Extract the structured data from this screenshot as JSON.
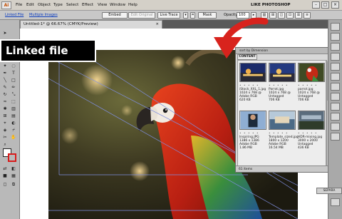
{
  "menubar": {
    "logo": "Ai",
    "items": [
      "File",
      "Edit",
      "Object",
      "Type",
      "Select",
      "Effect",
      "View",
      "Window",
      "Help"
    ],
    "app_title": "LIKE PHOTOSHOP",
    "window_buttons": [
      "–",
      "□",
      "×"
    ]
  },
  "controlbar": {
    "linked_file": "Linked File",
    "multiple_images": "Multiple Images",
    "embed": "Embed",
    "edit_original": "Edit Original",
    "live_trace": "Live Trace",
    "mask": "Mask",
    "opacity_label": "Opacity:",
    "opacity_value": "100"
  },
  "document": {
    "tab_title": "Untitled-1* @ 66.67% (CMYK/Preview)",
    "close": "×"
  },
  "callout": {
    "text": "Linked file"
  },
  "links_panel": {
    "header": "sort by Dimension",
    "tab": "CONTENT",
    "items": [
      {
        "name": "",
        "meta1": "",
        "meta2": "",
        "meta3": ""
      },
      {
        "name": "",
        "meta1": "",
        "meta2": "",
        "meta3": ""
      },
      {
        "name": "",
        "meta1": "",
        "meta2": "",
        "meta3": ""
      },
      {
        "name": "iStock_XXL_1.jpg",
        "meta1": "1024 x 768 @",
        "meta2": "Adobe RGB",
        "meta3": "620 KB"
      },
      {
        "name": "Parrot.jpg",
        "meta1": "1024 x 768 @",
        "meta2": "Untagged",
        "meta3": "706 KB"
      },
      {
        "name": "parrot.jpg",
        "meta1": "1024 x 768 @",
        "meta2": "Untagged",
        "meta3": "706 KB"
      },
      {
        "name": "Inspiring.JPG",
        "meta1": "1386 x 1386",
        "meta2": "Adobe RGB",
        "meta3": "1.86 MB"
      },
      {
        "name": "Template_sized.jpg",
        "meta1": "1800 x 1200",
        "meta2": "Adobe RGB",
        "meta3": "16.54 MB"
      },
      {
        "name": "HDR-mixing.jpg",
        "meta1": "3000 x 2000",
        "meta2": "Untagged",
        "meta3": "436 KB"
      }
    ],
    "footer": "61 items"
  },
  "dock": {
    "bottom_label": "SEPARA"
  },
  "colors": {
    "accent_red": "#d8231d",
    "link_blue": "#0f3fbf"
  }
}
